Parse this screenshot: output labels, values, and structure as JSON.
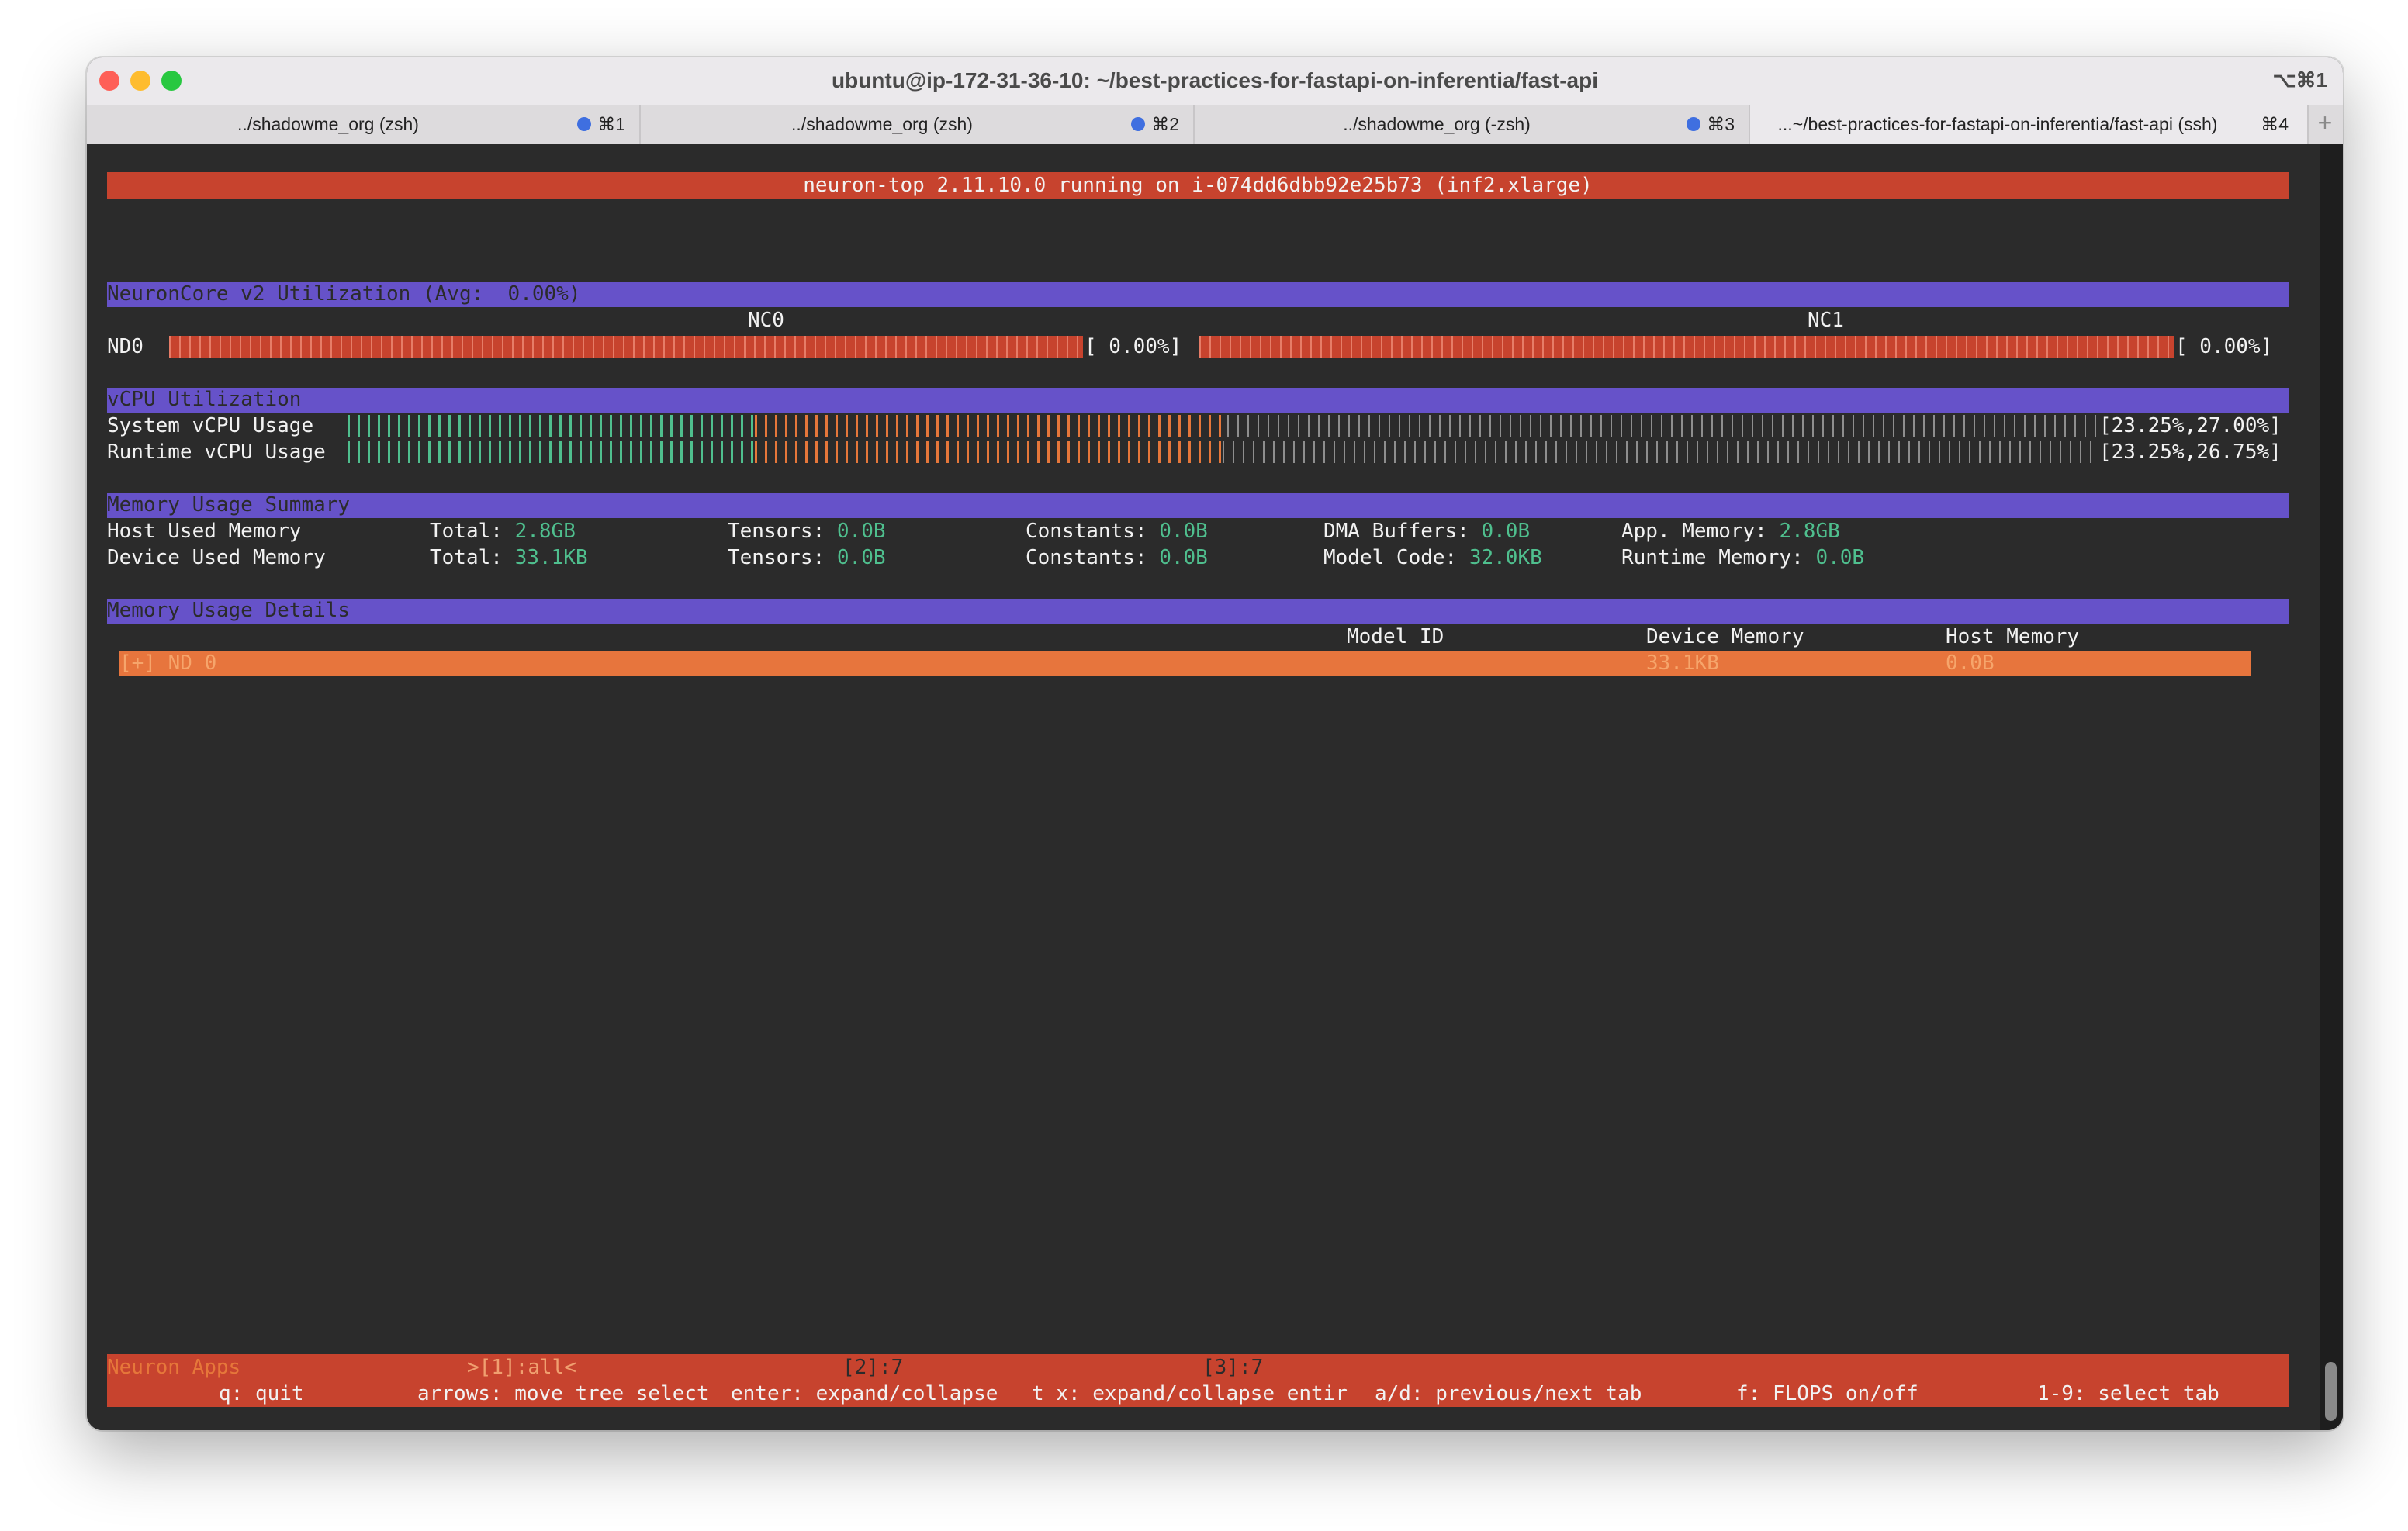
{
  "window": {
    "title": "ubuntu@ip-172-31-36-10: ~/best-practices-for-fastapi-on-inferentia/fast-api",
    "shortcut": "⌥⌘1",
    "new_tab_symbol": "+"
  },
  "tabs": [
    {
      "label": "../shadowme_org (zsh)",
      "shortcut": "⌘1",
      "has_dot": true,
      "active": false
    },
    {
      "label": "../shadowme_org (zsh)",
      "shortcut": "⌘2",
      "has_dot": true,
      "active": false
    },
    {
      "label": "../shadowme_org (-zsh)",
      "shortcut": "⌘3",
      "has_dot": true,
      "active": false
    },
    {
      "label": "...~/best-practices-for-fastapi-on-inferentia/fast-api (ssh)",
      "shortcut": "⌘4",
      "has_dot": false,
      "active": true
    }
  ],
  "colors": {
    "header_red": "#c7432e",
    "section_purple": "#6652c9",
    "value_green": "#4fbf8e",
    "accent_orange": "#e6773a",
    "terminal_bg": "#2b2b2b",
    "tab_dot_blue": "#3f6fe0"
  },
  "neuron_top": {
    "header": "neuron-top 2.11.10.0 running on i-074dd6dbb92e25b73 (inf2.xlarge)",
    "neuroncore": {
      "section_title": "NeuronCore v2 Utilization (Avg:  0.00%)",
      "nc0_label": "NC0",
      "nc1_label": "NC1",
      "device_label": "ND0",
      "nc0_value": "[ 0.00%]",
      "nc1_value": "[ 0.00%]",
      "nc0_percent": 0,
      "nc1_percent": 0
    },
    "vcpu": {
      "section_title": "vCPU Utilization",
      "rows": [
        {
          "label": "System vCPU Usage",
          "value": "[23.25%,27.00%]",
          "user_percent": 23.25,
          "system_percent": 27.0
        },
        {
          "label": "Runtime vCPU Usage",
          "value": "[23.25%,26.75%]",
          "user_percent": 23.25,
          "system_percent": 26.75
        }
      ]
    },
    "memory_summary": {
      "section_title": "Memory Usage Summary",
      "host": {
        "label": "Host Used Memory",
        "total_label": "Total:",
        "total": "2.8GB",
        "tensors_label": "Tensors:",
        "tensors": "0.0B",
        "constants_label": "Constants:",
        "constants": "0.0B",
        "dma_label": "DMA Buffers:",
        "dma": "0.0B",
        "app_label": "App. Memory:",
        "app": "2.8GB"
      },
      "device": {
        "label": "Device Used Memory",
        "total_label": "Total:",
        "total": "33.1KB",
        "tensors_label": "Tensors:",
        "tensors": "0.0B",
        "constants_label": "Constants:",
        "constants": "0.0B",
        "model_code_label": "Model Code:",
        "model_code": "32.0KB",
        "runtime_label": "Runtime Memory:",
        "runtime": "0.0B"
      }
    },
    "memory_details": {
      "section_title": "Memory Usage Details",
      "columns": [
        "Model ID",
        "Device Memory",
        "Host Memory"
      ],
      "row": {
        "name": "[+] ND 0",
        "model_id": "",
        "device_memory": "33.1KB",
        "host_memory": "0.0B"
      }
    },
    "footer": {
      "apps_label": "Neuron Apps",
      "app_tabs": [
        ">[1]:all<",
        "[2]:7",
        "[3]:7"
      ],
      "help": [
        "q: quit",
        "arrows: move tree select",
        "enter: expand/collapse",
        "t x: expand/collapse entir",
        "a/d: previous/next tab",
        "f: FLOPS on/off",
        "1-9: select tab"
      ]
    }
  }
}
